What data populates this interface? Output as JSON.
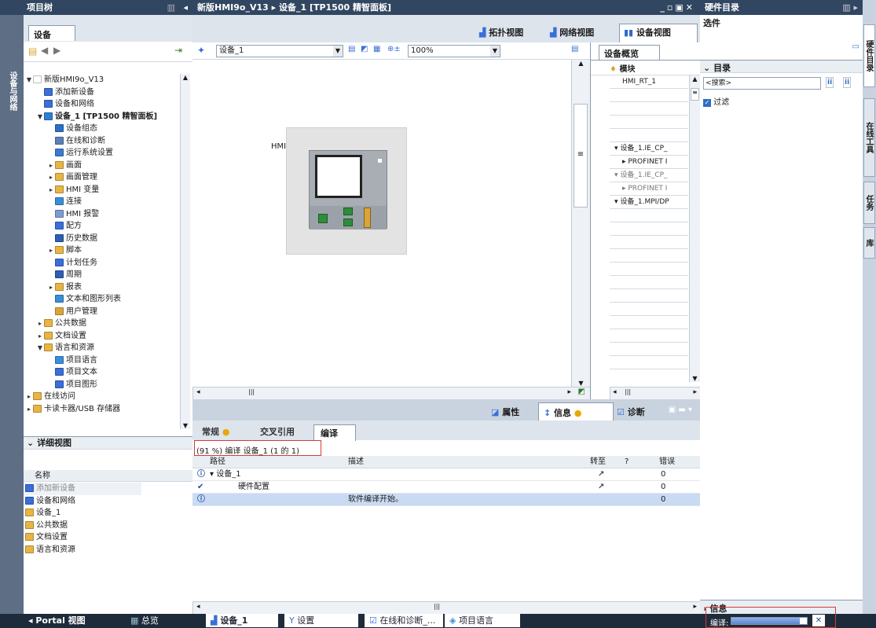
{
  "left_panel": {
    "title": "项目树",
    "side_label": "设备与网络",
    "section_title": "设备",
    "tree": [
      {
        "label": "新版HMI9o_V13",
        "indent": 0,
        "tri": "▼",
        "icon": "doc",
        "color": "#ffffff"
      },
      {
        "label": "添加新设备",
        "indent": 1,
        "tri": "",
        "icon": "add",
        "color": "#3a6ed8"
      },
      {
        "label": "设备和网络",
        "indent": 1,
        "tri": "",
        "icon": "net",
        "color": "#3a6ed8"
      },
      {
        "label": "设备_1 [TP1500 精智面板]",
        "indent": 1,
        "tri": "▼",
        "icon": "dev",
        "color": "#2d7fd6",
        "bold": true
      },
      {
        "label": "设备组态",
        "indent": 2,
        "tri": "",
        "icon": "cfg",
        "color": "#2d6ec6"
      },
      {
        "label": "在线和诊断",
        "indent": 2,
        "tri": "",
        "icon": "diag",
        "color": "#5a7fb8"
      },
      {
        "label": "运行系统设置",
        "indent": 2,
        "tri": "",
        "icon": "run",
        "color": "#3b7ad0"
      },
      {
        "label": "画面",
        "indent": 2,
        "tri": "▸",
        "icon": "folder",
        "color": "#e8b443"
      },
      {
        "label": "画面管理",
        "indent": 2,
        "tri": "▸",
        "icon": "folder",
        "color": "#e8b443"
      },
      {
        "label": "HMI 变量",
        "indent": 2,
        "tri": "▸",
        "icon": "folder",
        "color": "#e8b443"
      },
      {
        "label": "连接",
        "indent": 2,
        "tri": "",
        "icon": "conn",
        "color": "#3a8ed8"
      },
      {
        "label": "HMI 报警",
        "indent": 2,
        "tri": "",
        "icon": "alarm",
        "color": "#7f9bd0"
      },
      {
        "label": "配方",
        "indent": 2,
        "tri": "",
        "icon": "recipe",
        "color": "#3a6ed8"
      },
      {
        "label": "历史数据",
        "indent": 2,
        "tri": "",
        "icon": "hist",
        "color": "#2e5fb0"
      },
      {
        "label": "脚本",
        "indent": 2,
        "tri": "▸",
        "icon": "folder",
        "color": "#e8b443"
      },
      {
        "label": "计划任务",
        "indent": 2,
        "tri": "",
        "icon": "task",
        "color": "#3a6ed8"
      },
      {
        "label": "周期",
        "indent": 2,
        "tri": "",
        "icon": "cycle",
        "color": "#2e5fb0"
      },
      {
        "label": "报表",
        "indent": 2,
        "tri": "▸",
        "icon": "folder",
        "color": "#e8b443"
      },
      {
        "label": "文本和图形列表",
        "indent": 2,
        "tri": "",
        "icon": "text",
        "color": "#3a8ed8"
      },
      {
        "label": "用户管理",
        "indent": 2,
        "tri": "",
        "icon": "user",
        "color": "#d9a53a"
      },
      {
        "label": "公共数据",
        "indent": 1,
        "tri": "▸",
        "icon": "folder",
        "color": "#e8b443"
      },
      {
        "label": "文档设置",
        "indent": 1,
        "tri": "▸",
        "icon": "folder",
        "color": "#e8b443"
      },
      {
        "label": "语言和资源",
        "indent": 1,
        "tri": "▼",
        "icon": "folder",
        "color": "#e8b443"
      },
      {
        "label": "项目语言",
        "indent": 2,
        "tri": "",
        "icon": "lang",
        "color": "#3a8ed8"
      },
      {
        "label": "项目文本",
        "indent": 2,
        "tri": "",
        "icon": "ptext",
        "color": "#3a6ed8"
      },
      {
        "label": "项目图形",
        "indent": 2,
        "tri": "",
        "icon": "pimg",
        "color": "#3a6ed8"
      },
      {
        "label": "在线访问",
        "indent": 0,
        "tri": "▸",
        "icon": "folder",
        "color": "#e8b443"
      },
      {
        "label": "卡读卡器/USB 存储器",
        "indent": 0,
        "tri": "▸",
        "icon": "folder",
        "color": "#e8b443"
      }
    ],
    "detail_title": "详细视图",
    "detail_col": "名称",
    "detail_items": [
      {
        "label": "添加新设备",
        "color": "#3a6ed8"
      },
      {
        "label": "设备和网络",
        "color": "#3a6ed8"
      },
      {
        "label": "设备_1",
        "color": "#e8b443"
      },
      {
        "label": "公共数据",
        "color": "#e8b443"
      },
      {
        "label": "文档设置",
        "color": "#e8b443"
      },
      {
        "label": "语言和资源",
        "color": "#e8b443"
      }
    ]
  },
  "center": {
    "title_path": "新版HMI9o_V13 ▸ 设备_1 [TP1500 精智面板]",
    "view_tabs": [
      "拓扑视图",
      "网络视图",
      "设备视图"
    ],
    "device_select": "设备_1",
    "zoom": "100%",
    "hmi_label": "HMI",
    "overview_tab": "设备概览",
    "overview_header": "模块",
    "overview_rows": [
      "HMI_RT_1",
      "",
      "",
      "",
      "",
      "▾ 设备_1.IE_CP_",
      "▸ PROFINET I",
      "▾ 设备_1.IE_CP_",
      "▸ PROFINET I",
      "▾ 设备_1.MPI/DP",
      "",
      "",
      "",
      "",
      "",
      "",
      "",
      "",
      "",
      "",
      "",
      "",
      ""
    ],
    "inspector_tabs": [
      "属性",
      "信息",
      "诊断"
    ],
    "info_tabs": [
      "常规",
      "交叉引用",
      "编译"
    ],
    "progress_text": "(91 %) 编译 设备_1 (1 的 1)",
    "cols": [
      "路径",
      "描述",
      "转至",
      "?",
      "错误"
    ],
    "rows": [
      {
        "icon": "info",
        "path": "▾ 设备_1",
        "desc": "",
        "goto": "↗",
        "err": "0"
      },
      {
        "icon": "ok",
        "path": "硬件配置",
        "desc": "",
        "goto": "↗",
        "err": "0"
      },
      {
        "icon": "info",
        "path": "",
        "desc": "软件编译开始。",
        "goto": "",
        "err": "0"
      }
    ]
  },
  "right_panel": {
    "title": "硬件目录",
    "options": "选件",
    "catalog": "目录",
    "search_placeholder": "<搜索>",
    "filter": "过滤",
    "info": "信息",
    "side_tabs": [
      "硬件目录",
      "在线工具",
      "任务",
      "库"
    ]
  },
  "taskbar": {
    "portal": "Portal 视图",
    "overview": "总览",
    "tabs": [
      "设备_1",
      "设置",
      "在线和诊断_...",
      "项目语言"
    ],
    "compile_label": "编译:"
  }
}
